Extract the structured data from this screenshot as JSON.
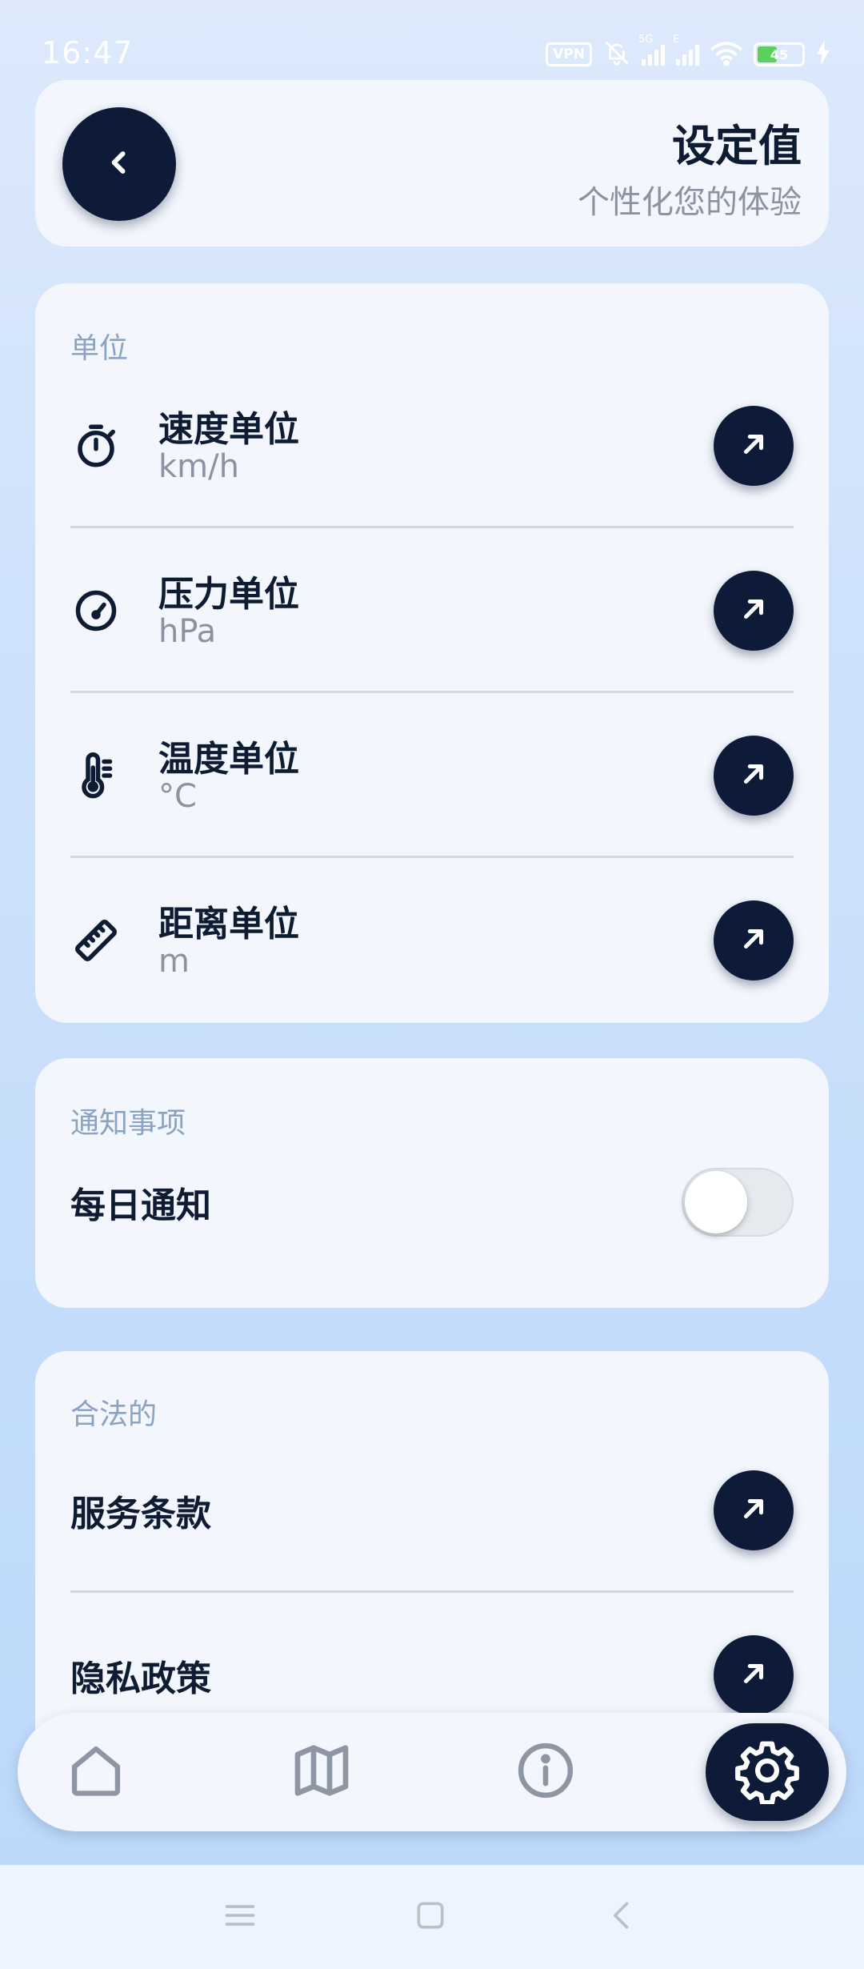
{
  "status_bar": {
    "time": "16:47",
    "vpn": "VPN",
    "network_5g": "5G",
    "network_e": "E",
    "battery": "45"
  },
  "header": {
    "title": "设定值",
    "subtitle": "个性化您的体验"
  },
  "units_section": {
    "label": "单位",
    "items": [
      {
        "title": "速度单位",
        "value": "km/h",
        "icon": "stopwatch-icon"
      },
      {
        "title": "压力单位",
        "value": "hPa",
        "icon": "gauge-icon"
      },
      {
        "title": "温度单位",
        "value": "°C",
        "icon": "thermometer-icon"
      },
      {
        "title": "距离单位",
        "value": "m",
        "icon": "ruler-icon"
      }
    ]
  },
  "notifications_section": {
    "label": "通知事项",
    "daily_label": "每日通知",
    "daily_enabled": false
  },
  "legal_section": {
    "label": "合法的",
    "items": [
      {
        "title": "服务条款"
      },
      {
        "title": "隐私政策"
      }
    ]
  },
  "bottom_nav": {
    "items": [
      "home-icon",
      "map-icon",
      "info-icon",
      "settings-icon"
    ],
    "active": "settings-icon"
  },
  "colors": {
    "primary_dark": "#0d1b38",
    "card_bg": "#f3f6fc",
    "section_label": "#8aa3c2",
    "secondary_text": "#8b93a2"
  }
}
